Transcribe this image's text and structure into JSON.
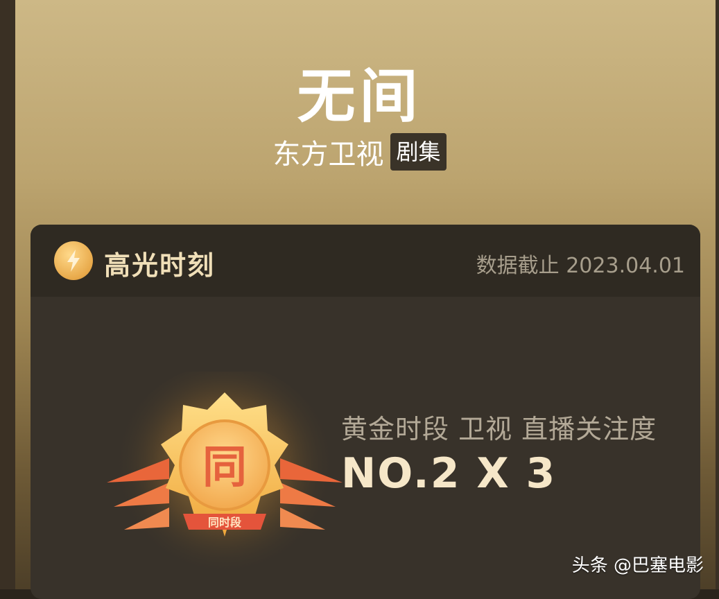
{
  "show": {
    "title": "无间",
    "channel": "东方卫视",
    "type_badge": "剧集"
  },
  "highlight": {
    "header_title": "高光时刻",
    "data_date": "数据截止 2023.04.01",
    "medal_char": "同",
    "medal_ribbon": "同时段",
    "rank_label": "黄金时段 卫视 直播关注度",
    "rank_value": "NO.2 X 3"
  },
  "watermark": "头条 @巴塞电影",
  "colors": {
    "accent_gold": "#f0dfb8",
    "card_bg": "#38322a",
    "badge_bg": "#3a3328"
  }
}
